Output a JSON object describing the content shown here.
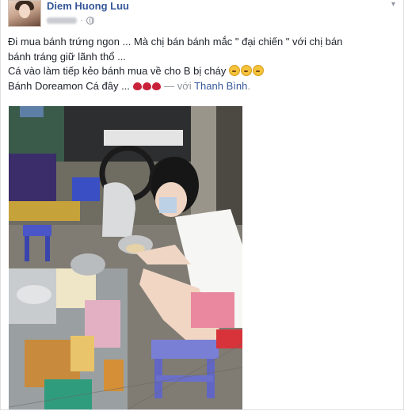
{
  "post": {
    "author": "Diem Huong Luu",
    "privacy_icon": "globe-icon",
    "menu_icon": "chevron-down-icon",
    "lines": [
      "Đi mua bánh trứng ngon ... Mà chị bán bánh mắc \" đại chiến \" với chị bán",
      "bánh tráng giữ lãnh thổ ...",
      "Cá vào làm tiếp kẻo bánh mua về cho B bị cháy"
    ],
    "line4_text": "Bánh Doreamon Cá đây ...",
    "with_text": "— với",
    "tagged_friend": "Thanh Bình",
    "tagged_suffix": "."
  },
  "colors": {
    "link": "#365899",
    "meta": "#90949c",
    "text": "#1d2129"
  }
}
